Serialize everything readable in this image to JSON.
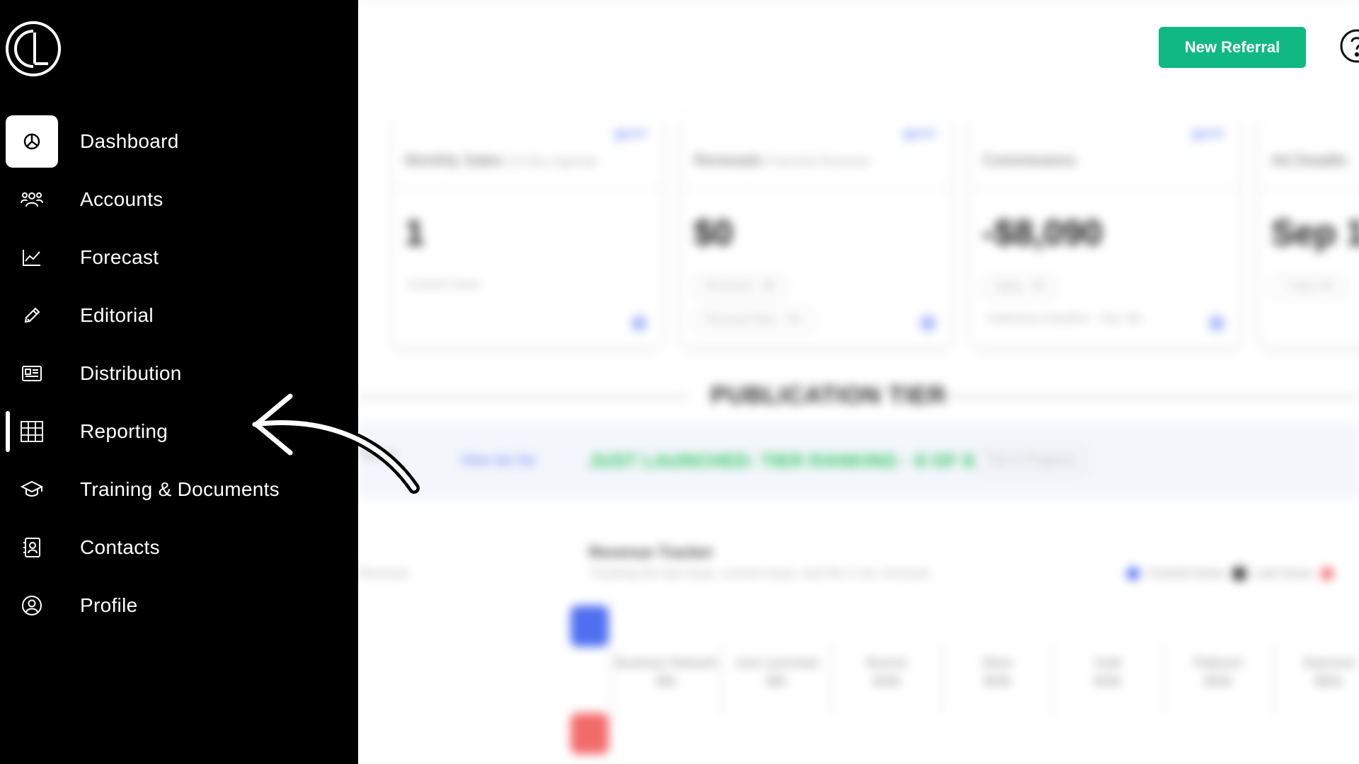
{
  "sidebar": {
    "logo": "CL",
    "items": [
      {
        "label": "Dashboard",
        "icon": "pie-chart-icon",
        "active": true
      },
      {
        "label": "Accounts",
        "icon": "users-icon"
      },
      {
        "label": "Forecast",
        "icon": "line-chart-icon"
      },
      {
        "label": "Editorial",
        "icon": "pencil-icon"
      },
      {
        "label": "Distribution",
        "icon": "newspaper-icon"
      },
      {
        "label": "Reporting",
        "icon": "grid-table-icon",
        "indicator": true
      },
      {
        "label": "Training & Documents",
        "icon": "graduation-cap-icon"
      },
      {
        "label": "Contacts",
        "icon": "contact-book-icon"
      },
      {
        "label": "Profile",
        "icon": "user-circle-icon"
      }
    ]
  },
  "header": {
    "new_referral": "New Referral",
    "help_icon": "help-circle-icon"
  },
  "cards": [
    {
      "tag": "Q3 FY",
      "title": "Monthly Sales",
      "subtitle": "On-Box Agenda",
      "value": "1",
      "pills": [],
      "note": "Current Issue"
    },
    {
      "tag": "Q3 FY",
      "title": "Renewals",
      "subtitle": "Potential Renewal",
      "value": "$0",
      "pills": [
        "Renewed · $0",
        "Renewal Rate · 0%"
      ],
      "note": ""
    },
    {
      "tag": "Q3 FY",
      "title": "Commissions",
      "subtitle": "",
      "value": "-$8,090",
      "pills": [
        "Aging · $0",
        "Collections Deadline · Sep. 9th"
      ],
      "note": ""
    },
    {
      "tag": "",
      "title": "Ad Deadlin",
      "subtitle": "",
      "value": "Sep 1",
      "pills": [
        "7 days left"
      ],
      "note": ""
    }
  ],
  "tier": {
    "title": "PUBLICATION TIER",
    "dropdown": "Tiers",
    "link": "View tier list",
    "headline": "JUST LAUNCHED: TIER RANKING · 8 OF 8",
    "pill": "Tier in Progress"
  },
  "revenue": {
    "left_fragment": "Revenue",
    "title": "Revenue Tracker",
    "subtitle": "Tracking the last issue, current issue, and the 2 mo. forecast",
    "legend": [
      {
        "label": "Current Issue",
        "color": "#4f6ff0"
      },
      {
        "label": "Last Issue",
        "color": "#333333"
      },
      {
        "label": "",
        "color": "#f26b6b"
      }
    ],
    "tiers": [
      {
        "name": "Business Network",
        "value": "$0k"
      },
      {
        "name": "Just Launched",
        "value": "$0k"
      },
      {
        "name": "Bronze",
        "value": "$20k"
      },
      {
        "name": "Silver",
        "value": "$30k"
      },
      {
        "name": "Gold",
        "value": "$35k"
      },
      {
        "name": "Platinum",
        "value": "$50k"
      },
      {
        "name": "Diamond",
        "value": "$60k"
      }
    ]
  },
  "colors": {
    "sidebar_bg": "#000000",
    "accent_green": "#10b981",
    "link_blue": "#5b7cf7",
    "headline_green": "#22c55e"
  }
}
